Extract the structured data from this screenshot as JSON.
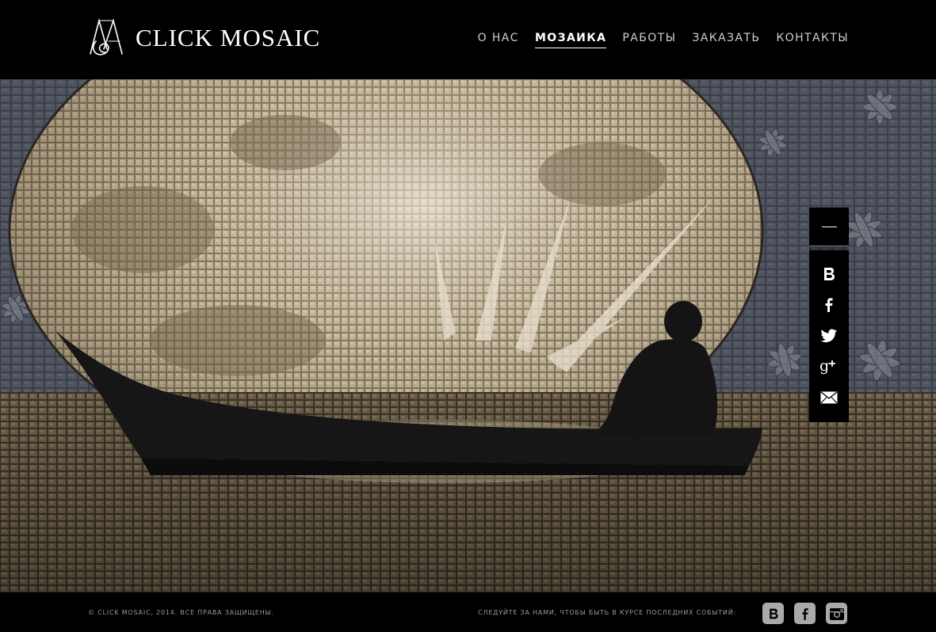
{
  "header": {
    "brand": "CLICK MOSAIC",
    "nav": [
      {
        "label": "О НАС",
        "active": false
      },
      {
        "label": "МОЗАИКА",
        "active": true
      },
      {
        "label": "РАБОТЫ",
        "active": false
      },
      {
        "label": "ЗАКАЗАТЬ",
        "active": false
      },
      {
        "label": "КОНТАКТЫ",
        "active": false
      }
    ]
  },
  "hero": {
    "image": "mosaic-moon-boat-figure"
  },
  "side_panel": {
    "icons": [
      "vk-icon",
      "facebook-icon",
      "twitter-icon",
      "google-plus-icon",
      "mail-icon"
    ]
  },
  "footer": {
    "copyright": "© CLICK MOSAIC, 2014. ВСЕ ПРАВА ЗАЩИЩЕНЫ.",
    "follow_text": "СЛЕДУЙТЕ ЗА НАМИ, ЧТОБЫ БЫТЬ В КУРСЕ ПОСЛЕДНИХ СОБЫТИЙ:",
    "social_icons": [
      "vk-icon",
      "facebook-icon",
      "instagram-icon"
    ]
  },
  "colors": {
    "background": "#000000",
    "text": "#ffffff",
    "muted_text": "#9a9a9a",
    "footer_icon": "#a9a9a9"
  }
}
